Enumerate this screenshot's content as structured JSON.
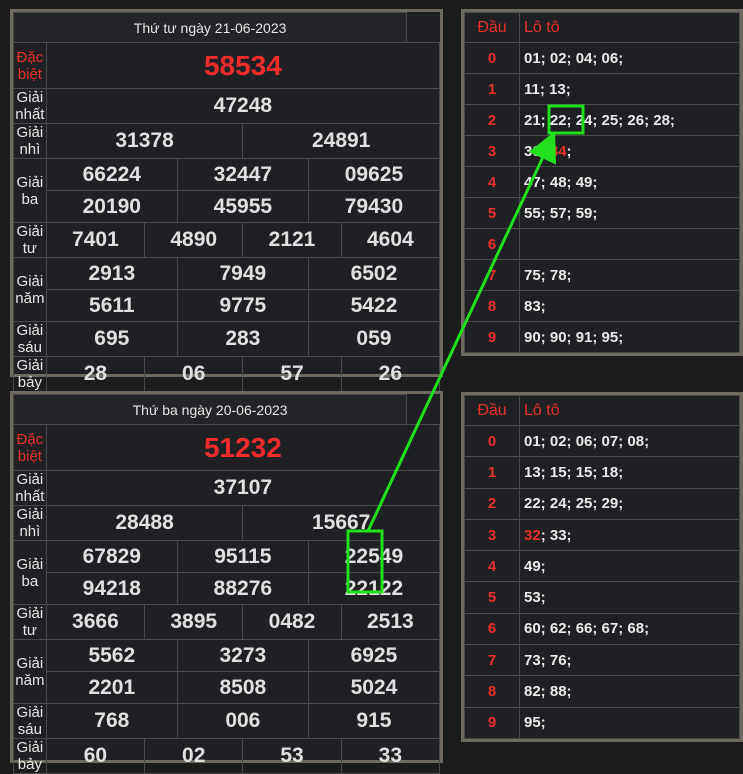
{
  "results": [
    {
      "date_label": "Thứ tư ngày 21-06-2023",
      "prizes": [
        {
          "label": "Đặc biệt",
          "rows": [
            [
              "58534"
            ]
          ]
        },
        {
          "label": "Giải nhất",
          "rows": [
            [
              "47248"
            ]
          ]
        },
        {
          "label": "Giải nhì",
          "rows": [
            [
              "31378",
              "24891"
            ]
          ]
        },
        {
          "label": "Giải ba",
          "rows": [
            [
              "66224",
              "32447",
              "09625"
            ],
            [
              "20190",
              "45955",
              "79430"
            ]
          ]
        },
        {
          "label": "Giải tư",
          "rows": [
            [
              "7401",
              "4890",
              "2121",
              "4604"
            ]
          ]
        },
        {
          "label": "Giải năm",
          "rows": [
            [
              "2913",
              "7949",
              "6502"
            ],
            [
              "5611",
              "9775",
              "5422"
            ]
          ]
        },
        {
          "label": "Giải sáu",
          "rows": [
            [
              "695",
              "283",
              "059"
            ]
          ]
        },
        {
          "label": "Giải bảy",
          "rows": [
            [
              "28",
              "06",
              "57",
              "26"
            ]
          ]
        }
      ],
      "loto": {
        "head_label": "Đầu",
        "value_label": "Lô tô",
        "rows": [
          {
            "head": "0",
            "values": "01; 02; 04; 06;"
          },
          {
            "head": "1",
            "values": "11; 13;"
          },
          {
            "head": "2",
            "values": "21; 22; 24; 25; 26; 28;"
          },
          {
            "head": "3",
            "values": "30; 34;"
          },
          {
            "head": "4",
            "values": "47; 48; 49;"
          },
          {
            "head": "5",
            "values": "55; 57; 59;"
          },
          {
            "head": "6",
            "values": ""
          },
          {
            "head": "7",
            "values": "75; 78;"
          },
          {
            "head": "8",
            "values": "83;"
          },
          {
            "head": "9",
            "values": "90; 90; 91; 95;"
          }
        ]
      }
    },
    {
      "date_label": "Thứ ba ngày 20-06-2023",
      "prizes": [
        {
          "label": "Đặc biệt",
          "rows": [
            [
              "51232"
            ]
          ]
        },
        {
          "label": "Giải nhất",
          "rows": [
            [
              "37107"
            ]
          ]
        },
        {
          "label": "Giải nhì",
          "rows": [
            [
              "28488",
              "15667"
            ]
          ]
        },
        {
          "label": "Giải ba",
          "rows": [
            [
              "67829",
              "95115",
              "22549"
            ],
            [
              "94218",
              "88276",
              "22122"
            ]
          ]
        },
        {
          "label": "Giải tư",
          "rows": [
            [
              "3666",
              "3895",
              "0482",
              "2513"
            ]
          ]
        },
        {
          "label": "Giải năm",
          "rows": [
            [
              "5562",
              "3273",
              "6925"
            ],
            [
              "2201",
              "8508",
              "5024"
            ]
          ]
        },
        {
          "label": "Giải sáu",
          "rows": [
            [
              "768",
              "006",
              "915"
            ]
          ]
        },
        {
          "label": "Giải bảy",
          "rows": [
            [
              "60",
              "02",
              "53",
              "33"
            ]
          ]
        }
      ],
      "loto": {
        "head_label": "Đầu",
        "value_label": "Lô tô",
        "rows": [
          {
            "head": "0",
            "values": "01; 02; 06; 07; 08;"
          },
          {
            "head": "1",
            "values": "13; 15; 15; 18;"
          },
          {
            "head": "2",
            "values": "22; 24; 25; 29;"
          },
          {
            "head": "3",
            "values": "32; 33;"
          },
          {
            "head": "4",
            "values": "49;"
          },
          {
            "head": "5",
            "values": "53;"
          },
          {
            "head": "6",
            "values": "60; 62; 66; 67; 68;"
          },
          {
            "head": "7",
            "values": "73; 76;"
          },
          {
            "head": "8",
            "values": "82; 88;"
          },
          {
            "head": "9",
            "values": "95;"
          }
        ]
      }
    }
  ],
  "colors": {
    "highlight": "#22e01e",
    "special": "#f22b2b",
    "accent": "#e8302c"
  }
}
